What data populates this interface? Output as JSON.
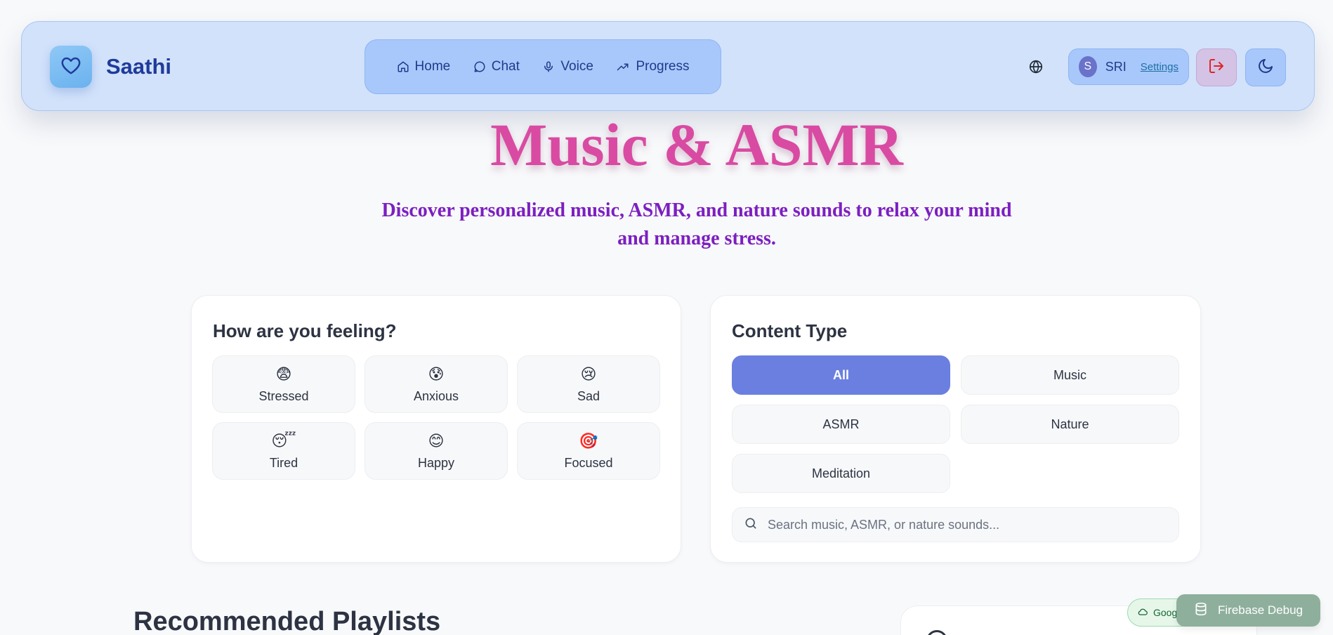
{
  "header": {
    "brand": "Saathi",
    "nav": [
      {
        "label": "Home",
        "icon": "home-icon"
      },
      {
        "label": "Chat",
        "icon": "chat-icon"
      },
      {
        "label": "Voice",
        "icon": "mic-icon"
      },
      {
        "label": "Progress",
        "icon": "trending-up-icon"
      }
    ],
    "user": {
      "initial": "S",
      "name": "SRI",
      "settings_label": "Settings"
    },
    "icons": {
      "logo": "heart-icon",
      "language": "globe-icon",
      "logout": "logout-icon",
      "theme": "moon-icon"
    }
  },
  "hero": {
    "title": "Music & ASMR",
    "subtitle": "Discover personalized music, ASMR, and nature sounds to relax your mind and manage stress."
  },
  "mood_card": {
    "title": "How are you feeling?",
    "moods": [
      {
        "emoji": "😨",
        "label": "Stressed"
      },
      {
        "emoji": "😰",
        "label": "Anxious"
      },
      {
        "emoji": "😢",
        "label": "Sad"
      },
      {
        "emoji": "😴",
        "label": "Tired"
      },
      {
        "emoji": "😊",
        "label": "Happy"
      },
      {
        "emoji": "🎯",
        "label": "Focused"
      }
    ]
  },
  "content_card": {
    "title": "Content Type",
    "types": [
      "All",
      "Music",
      "ASMR",
      "Nature",
      "Meditation"
    ],
    "selected": "All",
    "search_placeholder": "Search music, ASMR, or nature sounds..."
  },
  "sections": {
    "recommended_title": "Recommended Playlists"
  },
  "footer_widgets": {
    "google_label": "Google",
    "debug_label": "Firebase Debug"
  },
  "colors": {
    "accent": "#6b7fe0",
    "hero_title": "#d94aa2",
    "hero_subtitle": "#7c1fc0",
    "brand": "#1f3b9a"
  }
}
